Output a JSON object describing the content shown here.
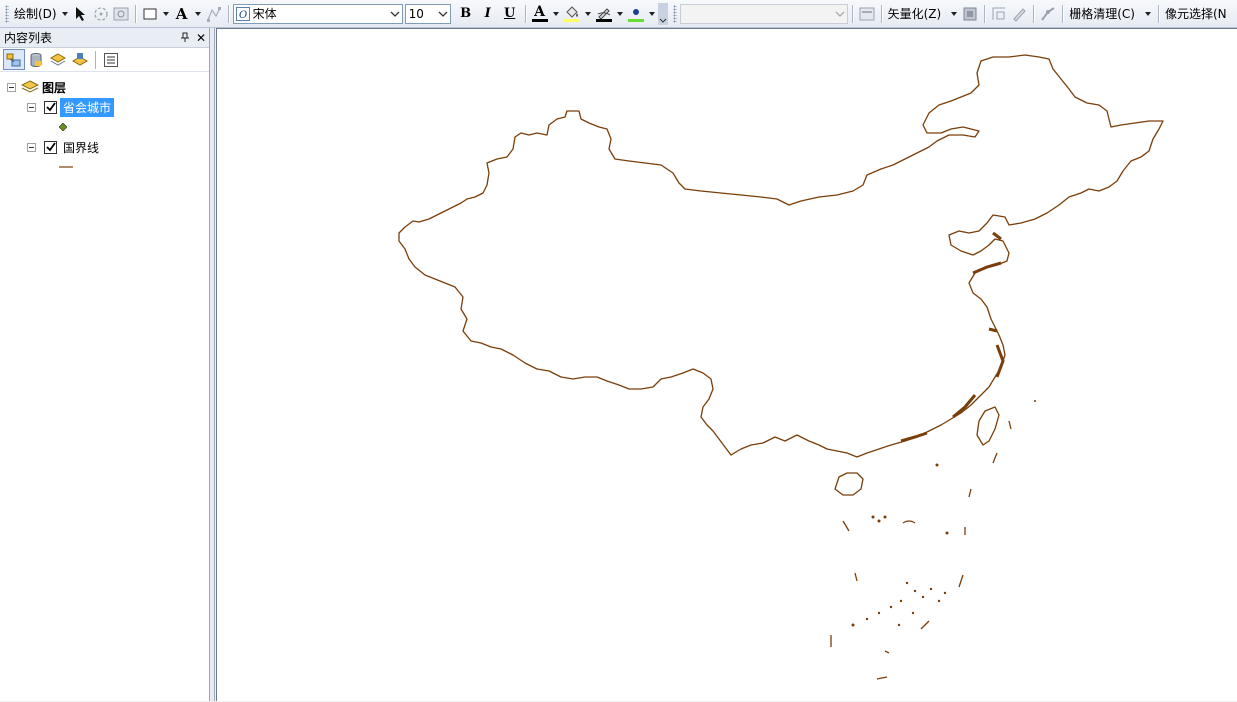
{
  "toolbar": {
    "draw_label": "绘制(D)",
    "font_name": "宋体",
    "font_size": "10",
    "bold_label": "B",
    "italic_label": "I",
    "underline_label": "U",
    "font_color_label": "A",
    "vectorize_label": "矢量化(Z)",
    "raster_clean_label": "栅格清理(C)",
    "pixel_select_label": "像元选择(N"
  },
  "toc": {
    "title": "内容列表",
    "pin_label": "ㅍ",
    "close_label": "✕",
    "root_label": "图层",
    "layers": [
      {
        "name": "省会城市",
        "checked": true,
        "selected": true
      },
      {
        "name": "国界线",
        "checked": true,
        "selected": false
      }
    ]
  },
  "colors": {
    "boundary": "#7a3e0a",
    "point_symbol": "#6b8e23",
    "selection": "#3399ff",
    "fill_highlight": "#ffff66",
    "line_color": "#000000",
    "marker_fill": "#66dd33"
  }
}
